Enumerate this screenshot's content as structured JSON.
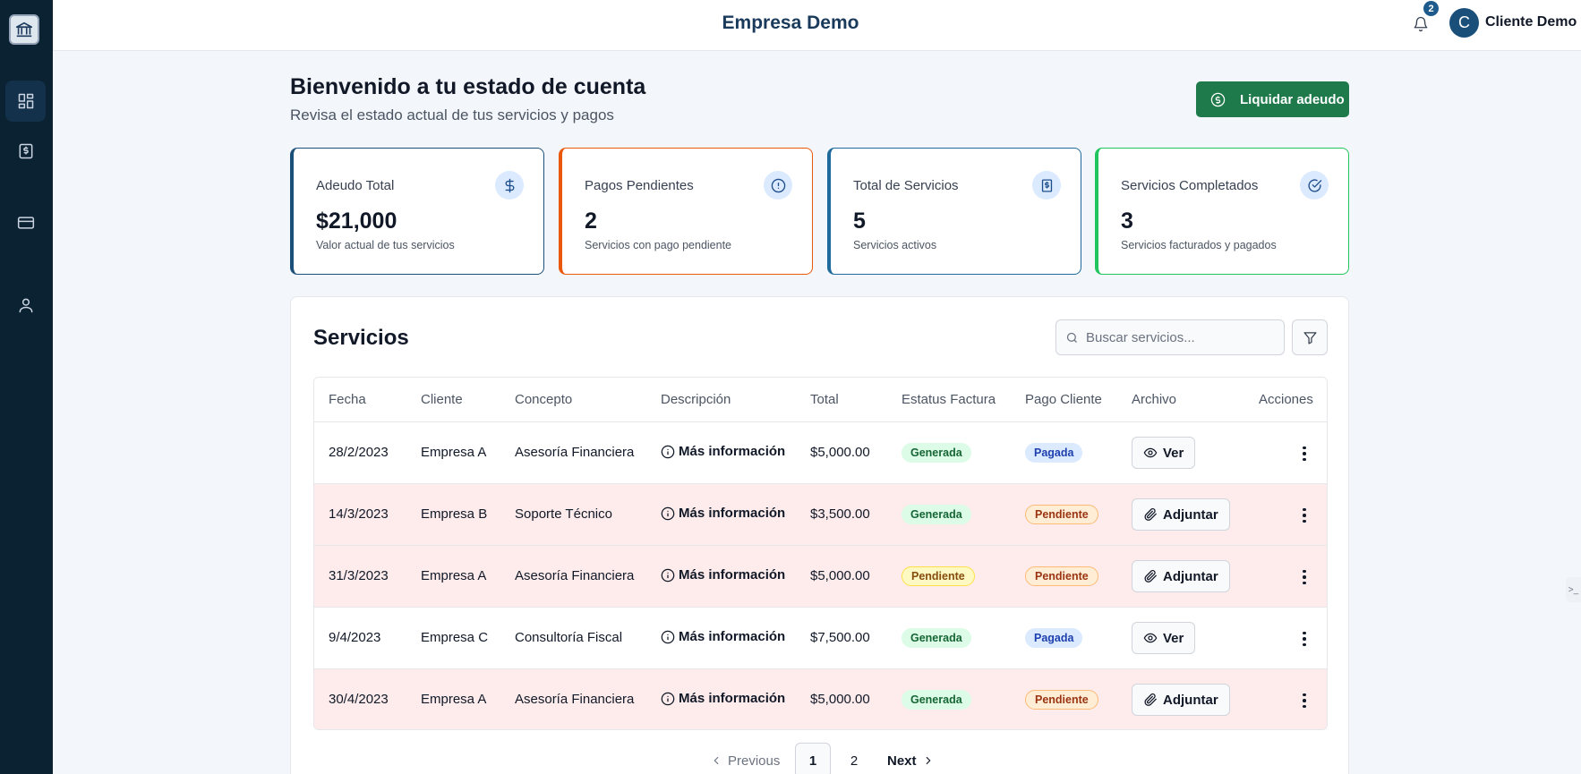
{
  "header": {
    "app_title": "Empresa Demo",
    "notification_count": "2",
    "avatar_initial": "C",
    "user_name": "Cliente Demo"
  },
  "sidebar": {
    "items": [
      {
        "icon": "dashboard-icon",
        "active": true
      },
      {
        "icon": "invoice-icon",
        "active": false
      },
      {
        "icon": "credit-card-icon",
        "active": false
      },
      {
        "icon": "user-icon",
        "active": false
      }
    ]
  },
  "page": {
    "title": "Bienvenido a tu estado de cuenta",
    "subtitle": "Revisa el estado actual de tus servicios y pagos",
    "pay_button_label": "Liquidar adeudo"
  },
  "cards": [
    {
      "title": "Adeudo Total",
      "value": "$21,000",
      "desc": "Valor actual de tus servicios",
      "icon": "dollar-icon",
      "border_color": "#1a4f7a"
    },
    {
      "title": "Pagos Pendientes",
      "value": "2",
      "desc": "Servicios con pago pendiente",
      "icon": "alert-circle-icon",
      "border_color": "#ea580c"
    },
    {
      "title": "Total de Servicios",
      "value": "5",
      "desc": "Servicios activos",
      "icon": "receipt-icon",
      "border_color": "#1e6a9c"
    },
    {
      "title": "Servicios Completados",
      "value": "3",
      "desc": "Servicios facturados y pagados",
      "icon": "check-circle-icon",
      "border_color": "#22c55e"
    }
  ],
  "services": {
    "title": "Servicios",
    "search_placeholder": "Buscar servicios...",
    "columns": [
      "Fecha",
      "Cliente",
      "Concepto",
      "Descripción",
      "Total",
      "Estatus Factura",
      "Pago Cliente",
      "Archivo",
      "Acciones"
    ],
    "rows": [
      {
        "fecha": "28/2/2023",
        "cliente": "Empresa A",
        "concepto": "Asesoría Financiera",
        "descripcion": "Más información",
        "total": "$5,000.00",
        "estatus_factura": "Generada",
        "pago_cliente": "Pagada",
        "archivo": "Ver"
      },
      {
        "fecha": "14/3/2023",
        "cliente": "Empresa B",
        "concepto": "Soporte Técnico",
        "descripcion": "Más información",
        "total": "$3,500.00",
        "estatus_factura": "Generada",
        "pago_cliente": "Pendiente",
        "archivo": "Adjuntar"
      },
      {
        "fecha": "31/3/2023",
        "cliente": "Empresa A",
        "concepto": "Asesoría Financiera",
        "descripcion": "Más información",
        "total": "$5,000.00",
        "estatus_factura": "Pendiente",
        "pago_cliente": "Pendiente",
        "archivo": "Adjuntar"
      },
      {
        "fecha": "9/4/2023",
        "cliente": "Empresa C",
        "concepto": "Consultoría Fiscal",
        "descripcion": "Más información",
        "total": "$7,500.00",
        "estatus_factura": "Generada",
        "pago_cliente": "Pagada",
        "archivo": "Ver"
      },
      {
        "fecha": "30/4/2023",
        "cliente": "Empresa A",
        "concepto": "Asesoría Financiera",
        "descripcion": "Más información",
        "total": "$5,000.00",
        "estatus_factura": "Generada",
        "pago_cliente": "Pendiente",
        "archivo": "Adjuntar"
      }
    ]
  },
  "pagination": {
    "previous_label": "Previous",
    "pages": [
      "1",
      "2"
    ],
    "current_page": "1",
    "next_label": "Next"
  },
  "colors": {
    "sidebar_bg": "#0b2233",
    "primary": "#1a4f7a",
    "success_button": "#1e7a4a",
    "pending_row_bg": "#fdeceb"
  }
}
